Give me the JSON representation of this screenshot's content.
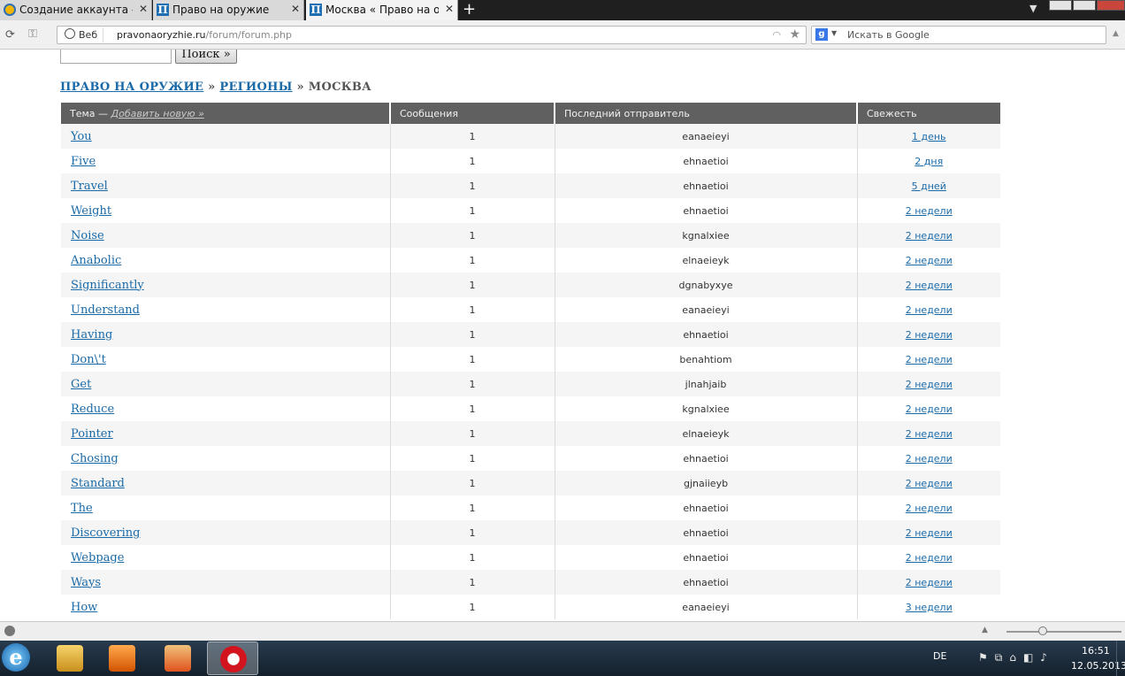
{
  "browser": {
    "tabs": [
      {
        "title": "Создание аккаунта - ......"
      },
      {
        "title": "Право на оружие"
      },
      {
        "title": "Москва « Право на ор..."
      }
    ],
    "web_label": "Веб",
    "url_host": "pravonaoryzhie.ru",
    "url_path": "/forum/forum.php",
    "search_placeholder": "Искать в Google",
    "site_fav_glyph": "П"
  },
  "page": {
    "search_button": "Поиск »",
    "breadcrumb": {
      "root": "ПРАВО НА ОРУЖИЕ",
      "sep1": "»",
      "regions": "РЕГИОНЫ",
      "sep2": "»",
      "current": "МОСКВА"
    },
    "table": {
      "headers": {
        "topic": "Тема —",
        "add_new": "Добавить новую »",
        "posts": "Сообщения",
        "last_poster": "Последний отправитель",
        "freshness": "Свежесть"
      },
      "rows": [
        {
          "topic": "You",
          "posts": "1",
          "author": "eanaeieyi",
          "fresh": "1 день"
        },
        {
          "topic": "Five",
          "posts": "1",
          "author": "ehnaetioi",
          "fresh": "2 дня"
        },
        {
          "topic": "Travel",
          "posts": "1",
          "author": "ehnaetioi",
          "fresh": "5 дней"
        },
        {
          "topic": "Weight",
          "posts": "1",
          "author": "ehnaetioi",
          "fresh": "2 недели"
        },
        {
          "topic": "Noise",
          "posts": "1",
          "author": "kgnalxiee",
          "fresh": "2 недели"
        },
        {
          "topic": "Anabolic",
          "posts": "1",
          "author": "elnaeieyk",
          "fresh": "2 недели"
        },
        {
          "topic": "Significantly",
          "posts": "1",
          "author": "dgnabyxye",
          "fresh": "2 недели"
        },
        {
          "topic": "Understand",
          "posts": "1",
          "author": "eanaeieyi",
          "fresh": "2 недели"
        },
        {
          "topic": "Having",
          "posts": "1",
          "author": "ehnaetioi",
          "fresh": "2 недели"
        },
        {
          "topic": "Don\\'t",
          "posts": "1",
          "author": "benahtiom",
          "fresh": "2 недели"
        },
        {
          "topic": "Get",
          "posts": "1",
          "author": "jlnahjaib",
          "fresh": "2 недели"
        },
        {
          "topic": "Reduce",
          "posts": "1",
          "author": "kgnalxiee",
          "fresh": "2 недели"
        },
        {
          "topic": "Pointer",
          "posts": "1",
          "author": "elnaeieyk",
          "fresh": "2 недели"
        },
        {
          "topic": "Chosing",
          "posts": "1",
          "author": "ehnaetioi",
          "fresh": "2 недели"
        },
        {
          "topic": "Standard",
          "posts": "1",
          "author": "gjnaiieyb",
          "fresh": "2 недели"
        },
        {
          "topic": "The",
          "posts": "1",
          "author": "ehnaetioi",
          "fresh": "2 недели"
        },
        {
          "topic": "Discovering",
          "posts": "1",
          "author": "ehnaetioi",
          "fresh": "2 недели"
        },
        {
          "topic": "Webpage",
          "posts": "1",
          "author": "ehnaetioi",
          "fresh": "2 недели"
        },
        {
          "topic": "Ways",
          "posts": "1",
          "author": "ehnaetioi",
          "fresh": "2 недели"
        },
        {
          "topic": "How",
          "posts": "1",
          "author": "eanaeieyi",
          "fresh": "3 недели"
        }
      ]
    }
  },
  "taskbar": {
    "start_glyph": "e",
    "apps": [
      "internet-explorer",
      "file-explorer",
      "media-player",
      "paint-app",
      "opera-browser"
    ],
    "active_app": "opera-browser",
    "language": "DE",
    "time": "16:51",
    "date": "12.05.2013"
  },
  "colors": {
    "link": "#1a6aa8",
    "table_header_bg": "#606060",
    "row_alt_bg": "#f5f5f5",
    "opera_red": "#d2141f"
  }
}
